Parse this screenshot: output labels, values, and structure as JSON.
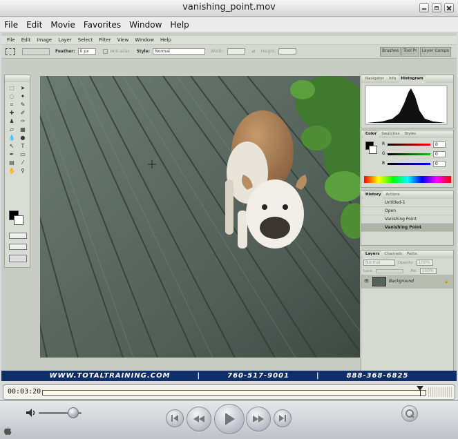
{
  "window": {
    "title": "vanishing_point.mov"
  },
  "menubar": [
    "File",
    "Edit",
    "Movie",
    "Favorites",
    "Window",
    "Help"
  ],
  "video": {
    "photoshop": {
      "menus": [
        "File",
        "Edit",
        "Image",
        "Layer",
        "Select",
        "Filter",
        "View",
        "Window",
        "Help"
      ],
      "options": {
        "feather_label": "Feather:",
        "feather_value": "0 px",
        "antialias_label": "Anti-alias",
        "style_label": "Style:",
        "style_value": "Normal",
        "width_label": "Width:",
        "height_label": "Height:"
      },
      "palette_well": [
        "Brushes",
        "Tool Pr",
        "Layer Comps"
      ],
      "navigator_tabs": [
        "Navigator",
        "Info",
        "Histogram"
      ],
      "color_tabs": [
        "Color",
        "Swatches",
        "Styles"
      ],
      "color_sliders": [
        {
          "label": "R",
          "value": "0"
        },
        {
          "label": "G",
          "value": "0"
        },
        {
          "label": "B",
          "value": "0"
        }
      ],
      "history_tabs": [
        "History",
        "Actions"
      ],
      "history_items": [
        {
          "label": "Untitled-1"
        },
        {
          "label": "Open"
        },
        {
          "label": "Vanishing Point"
        },
        {
          "label": "Vanishing Point"
        }
      ],
      "layers_tabs": [
        "Layers",
        "Channels",
        "Paths"
      ],
      "layers_blend": "Normal",
      "layers_opacity_label": "Opacity:",
      "layers_opacity": "100%",
      "layers_lock_label": "Lock:",
      "layers_fill_label": "Fill:",
      "layers_fill": "100%",
      "layers": [
        {
          "name": "Background"
        }
      ]
    },
    "banner": {
      "website": "WWW.TOTALTRAINING.COM",
      "separator": "|",
      "phone1": "760-517-9001",
      "phone2": "888-368-6825"
    }
  },
  "timebar": {
    "current_time": "00:03:20",
    "position_fraction": 0.984
  },
  "controls": {
    "volume_fraction": 0.8
  },
  "colors": {
    "banner_bg": "#0f2f6a",
    "deck": "#55625c"
  },
  "icons": [
    "volume-icon",
    "go-to-start-icon",
    "rewind-icon",
    "play-icon",
    "fast-forward-icon",
    "go-to-end-icon",
    "quicktime-logo-icon",
    "apple-icon"
  ]
}
